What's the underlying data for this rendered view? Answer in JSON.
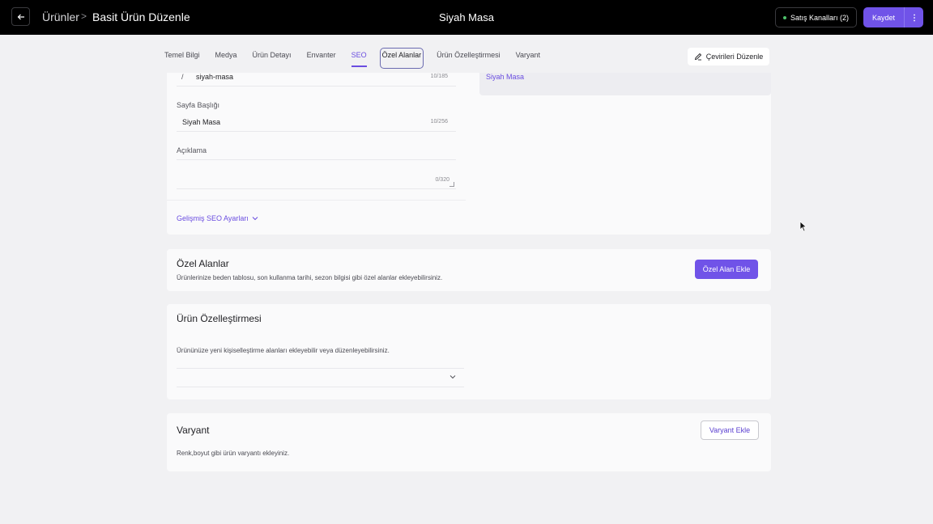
{
  "topbar": {
    "back_icon": "arrow-left-icon",
    "breadcrumb_parent": "Ürünler",
    "breadcrumb_separator": ">",
    "breadcrumb_current": "Basit Ürün Düzenle",
    "product_title": "Siyah Masa",
    "channels_label": "Satış Kanalları (2)",
    "save_label": "Kaydet",
    "more_icon": "vertical-dots-icon"
  },
  "tabs": [
    {
      "label": "Temel Bilgi"
    },
    {
      "label": "Medya"
    },
    {
      "label": "Ürün Detayı"
    },
    {
      "label": "Envanter"
    },
    {
      "label": "SEO"
    },
    {
      "label": "Özel Alanlar"
    },
    {
      "label": "Ürün Özelleştirmesi"
    },
    {
      "label": "Varyant"
    }
  ],
  "active_tab": "SEO",
  "translations_button": "Çevirileri Düzenle",
  "seo": {
    "slug_prefix": "/",
    "slug_value": "siyah-masa",
    "slug_count": "10/185",
    "page_title_label": "Sayfa Başlığı",
    "page_title_value": "Siyah Masa",
    "page_title_count": "10/256",
    "description_label": "Açıklama",
    "description_count": "0/320",
    "advanced_link": "Gelişmiş SEO Ayarları",
    "preview_title": "Siyah Masa"
  },
  "custom_fields": {
    "title": "Özel Alanlar",
    "description": "Ürünlerinize beden tablosu, son kullanma tarihi, sezon bilgisi gibi özel alanlar ekleyebilirsiniz.",
    "button": "Özel Alan Ekle"
  },
  "personalization": {
    "title": "Ürün Özelleştirmesi",
    "description": "Ürününüze yeni kişiselleştirme alanları ekleyebilir veya düzenleyebilirsiniz."
  },
  "variant": {
    "title": "Varyant",
    "description": "Renk,boyut gibi ürün varyantı ekleyiniz.",
    "button": "Varyant Ekle"
  },
  "colors": {
    "accent": "#7053e8",
    "topbar": "#000000",
    "status_green": "#4ec26b"
  }
}
